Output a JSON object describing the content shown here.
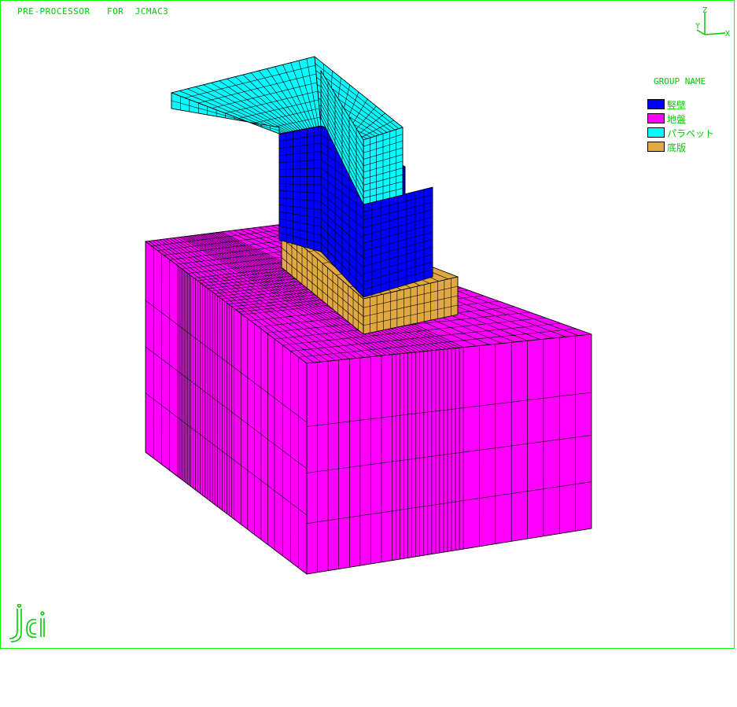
{
  "window": {
    "title": "PRE-PROCESSOR   FOR  JCMAC3"
  },
  "axes": {
    "z": "Z",
    "y": "Y",
    "x": "X",
    "color": "#00cc00"
  },
  "legend": {
    "title": "GROUP NAME",
    "items": [
      {
        "label": "竪壁",
        "color": "#0000ff"
      },
      {
        "label": "地盤",
        "color": "#ff00ff"
      },
      {
        "label": "パラペット",
        "color": "#00ffff"
      },
      {
        "label": "底版",
        "color": "#e0a840"
      }
    ]
  },
  "logo": {
    "text": "jci",
    "color": "#00cc00"
  },
  "colors": {
    "frame": "#00ff00",
    "text": "#00cc00",
    "mesh_line": "#000000"
  }
}
